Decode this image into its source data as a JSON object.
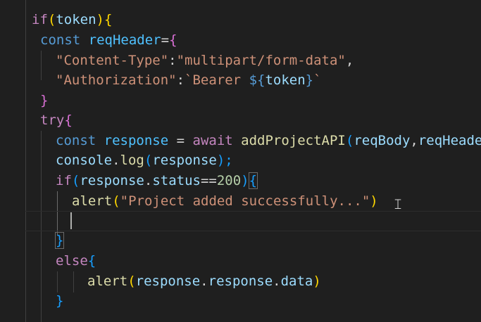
{
  "editor": {
    "colors": {
      "background": "#1f1f1f",
      "keyword": "#c586c0",
      "storage": "#569cd6",
      "variable": "#9cdcfe",
      "function": "#dcdcaa",
      "string": "#ce9178",
      "number": "#b5cea8"
    },
    "lines": [
      {
        "tokens": [
          "if",
          "(",
          "token",
          ")",
          "{"
        ]
      },
      {
        "tokens": [
          "const",
          "reqHeader",
          "=",
          "{"
        ]
      },
      {
        "tokens": [
          "\"Content-Type\"",
          ":",
          "\"multipart/form-data\"",
          ","
        ]
      },
      {
        "tokens": [
          "\"Authorization\"",
          ":",
          "`Bearer ",
          "${",
          "token",
          "}",
          "`"
        ]
      },
      {
        "tokens": [
          "}"
        ]
      },
      {
        "tokens": [
          "try",
          "{"
        ]
      },
      {
        "tokens": [
          "const",
          "response",
          " = ",
          "await",
          "addProjectAPI",
          "(",
          "reqBody",
          ",",
          "reqHeade"
        ]
      },
      {
        "tokens": [
          "console",
          ".",
          "log",
          "(",
          "response",
          ");"
        ]
      },
      {
        "tokens": [
          "if",
          "(",
          "response",
          ".",
          "status",
          "==",
          "200",
          ")",
          "{"
        ]
      },
      {
        "tokens": [
          "alert",
          "(",
          "\"Project added successfully...\"",
          ")"
        ]
      },
      {
        "tokens": []
      },
      {
        "tokens": [
          "}"
        ]
      },
      {
        "tokens": [
          "else",
          "{"
        ]
      },
      {
        "tokens": [
          "alert",
          "(",
          "response",
          ".",
          "response",
          ".",
          "data",
          ")"
        ]
      },
      {
        "tokens": [
          "}"
        ]
      }
    ]
  }
}
